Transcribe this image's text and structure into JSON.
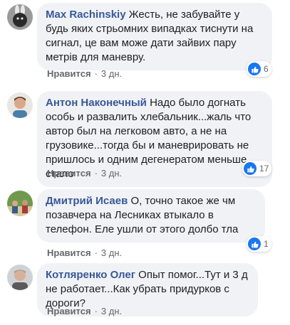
{
  "comments": [
    {
      "author": "Max Rachinskiy",
      "text": "Жесть, не забувайте у будь яких стрьомних випадках тиснути на сигнал, це вам може дати зайвих пару метрів для маневру.",
      "like_label": "Нравится",
      "time": "3 дн.",
      "reaction_count": "6"
    },
    {
      "author": "Антон Наконечный",
      "text": "Надо было догнать особь и развалить хлебальник...жаль что автор был на легковом авто, а не на грузовике...тогда бы и маневрировать не пришлось и одним дегенератом меньше стало",
      "like_label": "Нравится",
      "time": "3 дн.",
      "reaction_count": "17"
    },
    {
      "author": "Дмитрий Исаев",
      "text": "О, точно такое же чм     позавчера на Лесниках втыкало в телефон. Еле ушли от этого долбо     тла",
      "like_label": "Нравится",
      "time": "3 дн.",
      "reaction_count": "1"
    },
    {
      "author": "Котляренко Олег",
      "text": "Опыт помог...Тут и 3 д не работает...Как убрать придурков с дороги?",
      "like_label": "Нравится",
      "time": "3 дн.",
      "reaction_count": ""
    }
  ],
  "separator": "·",
  "colors": {
    "author": "#385898",
    "bubble": "#f0f2f5",
    "like_badge": "#1877f2"
  }
}
